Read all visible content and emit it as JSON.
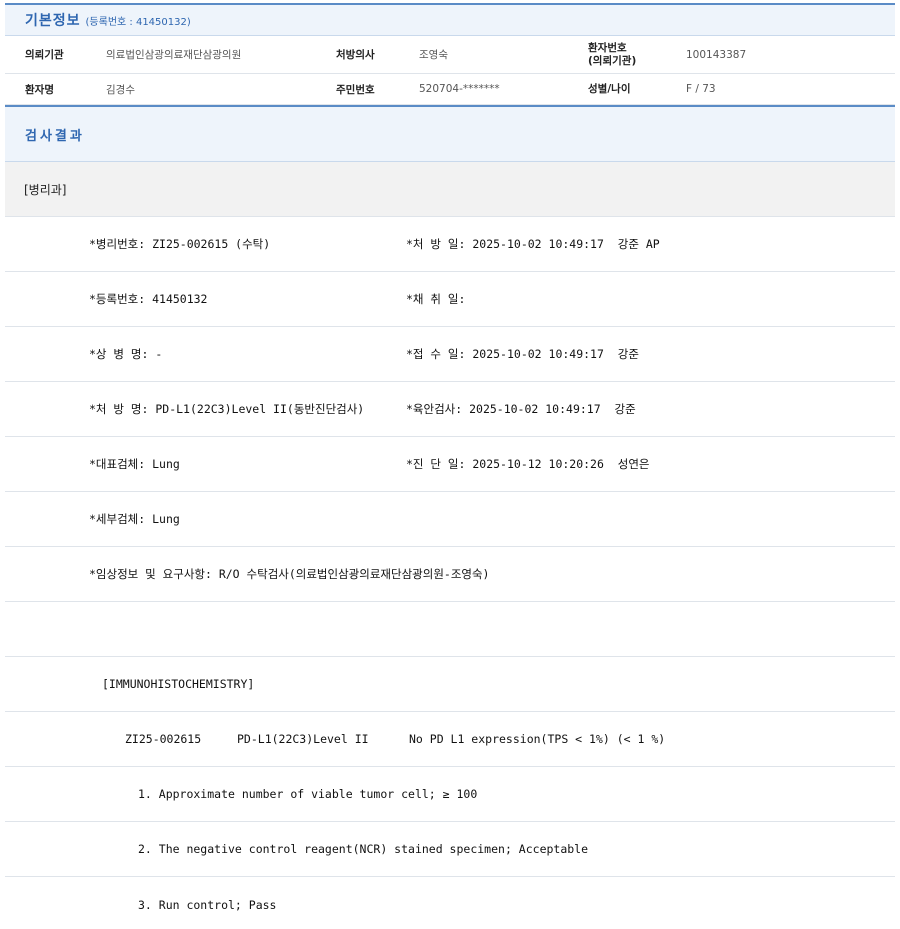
{
  "basic_info": {
    "title": "기본정보",
    "reg_label": "(등록번호 : 41450132)",
    "rows": [
      {
        "l1": "의뢰기관",
        "v1": "의료법인삼광의료재단삼광의원",
        "l2": "처방의사",
        "v2": "조영숙",
        "l3a": "환자번호",
        "l3b": "(의뢰기관)",
        "v3": "100143387"
      },
      {
        "l1": "환자명",
        "v1": "김경수",
        "l2": "주민번호",
        "v2": "520704-*******",
        "l3a": "성별/나이",
        "v3": "F / 73"
      }
    ]
  },
  "results": {
    "title": "검사결과",
    "department": "[병리과]",
    "fields": [
      {
        "a": "*병리번호: ZI25-002615 (수탁)",
        "b": "*처 방 일: 2025-10-02 10:49:17  강준 AP"
      },
      {
        "a": "*등록번호: 41450132",
        "b": "*채 취 일:"
      },
      {
        "a": "*상 병 명: -",
        "b": "*접 수 일: 2025-10-02 10:49:17  강준"
      },
      {
        "a": "*처 방 명: PD-L1(22C3)Level II(동반진단검사)",
        "b": "*육안검사: 2025-10-02 10:49:17  강준"
      },
      {
        "a": "*대표검체: Lung",
        "b": "*진 단 일: 2025-10-12 10:20:26  성연은"
      },
      {
        "a": "*세부검체: Lung",
        "b": ""
      },
      {
        "a": "*임상정보 및 요구사항: R/O 수탁검사(의료법인삼광의료재단삼광의원-조영숙)",
        "b": ""
      }
    ],
    "ihc_header": "[IMMUNOHISTOCHEMISTRY]",
    "ihc_row": {
      "id": "ZI25-002615",
      "test": "PD-L1(22C3)Level II",
      "result": "No PD L1 expression(TPS < 1%) (< 1 %)"
    },
    "items": [
      "1. Approximate number of viable tumor cell; ≥ 100",
      "2. The negative control reagent(NCR) stained specimen; Acceptable",
      "3. Run control; Pass"
    ]
  }
}
